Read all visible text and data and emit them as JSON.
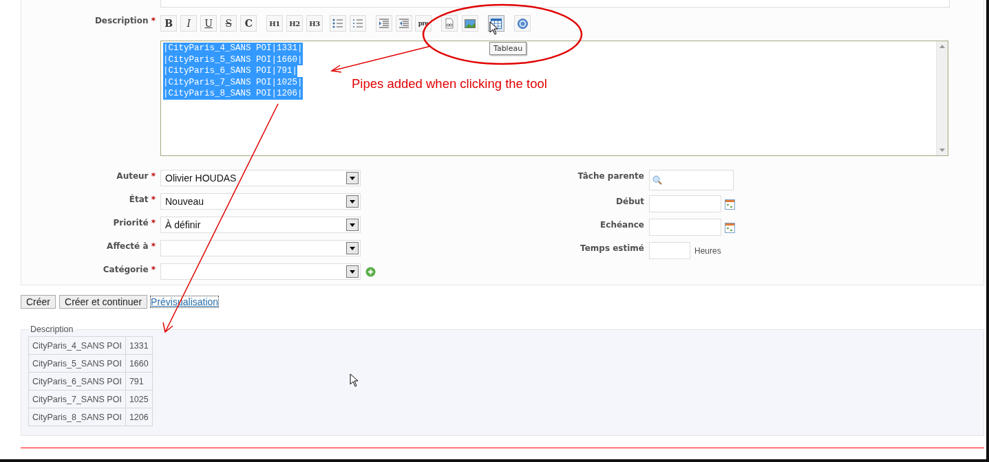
{
  "toolbar": [
    {
      "kind": "bold",
      "label": "B",
      "highlighted": false
    },
    {
      "kind": "italic",
      "label": "I",
      "highlighted": false
    },
    {
      "kind": "underline",
      "label": "U",
      "highlighted": false
    },
    {
      "kind": "strike",
      "label": "S",
      "highlighted": false
    },
    {
      "kind": "code",
      "label": "C",
      "highlighted": false
    },
    {
      "kind": "heading",
      "label": "H1",
      "highlighted": false
    },
    {
      "kind": "heading",
      "label": "H2",
      "highlighted": false
    },
    {
      "kind": "heading",
      "label": "H3",
      "highlighted": false
    },
    {
      "kind": "bullet-list",
      "highlighted": false
    },
    {
      "kind": "numbered-list",
      "highlighted": false
    },
    {
      "kind": "indent",
      "highlighted": false
    },
    {
      "kind": "outdent",
      "highlighted": false
    },
    {
      "kind": "pre",
      "label": "pre",
      "highlighted": false
    },
    {
      "kind": "link",
      "highlighted": false
    },
    {
      "kind": "image",
      "highlighted": false
    },
    {
      "kind": "table",
      "highlighted": true
    },
    {
      "kind": "help",
      "highlighted": false
    }
  ],
  "tooltip": {
    "text": "Tableau"
  },
  "description": {
    "label": "Description",
    "required_mark": "*",
    "selected": true,
    "lines": [
      "|CityParis_4_SANS POI|1331|",
      "|CityParis_5_SANS POI|1660|",
      "|CityParis_6_SANS POI|791|",
      "|CityParis_7_SANS POI|1025|",
      "|CityParis_8_SANS POI|1206|"
    ]
  },
  "left_fields": [
    {
      "label": "Auteur",
      "required_mark": "*",
      "value": "Olivier HOUDAS",
      "add_button": false
    },
    {
      "label": "État",
      "required_mark": "*",
      "value": "Nouveau",
      "add_button": false
    },
    {
      "label": "Priorité",
      "required_mark": "*",
      "value": "À définir",
      "add_button": false
    },
    {
      "label": "Affecté à",
      "required_mark": "*",
      "add_button": false
    },
    {
      "label": "Catégorie",
      "required_mark": "*",
      "add_button": true
    }
  ],
  "right_fields": [
    {
      "kind": "search",
      "label": "Tâche parente"
    },
    {
      "kind": "date",
      "label": "Début"
    },
    {
      "kind": "date",
      "label": "Echéance"
    },
    {
      "kind": "number",
      "label": "Temps estimé",
      "unit": "Heures"
    }
  ],
  "buttons": [
    "Créer",
    "Créer et continuer"
  ],
  "preview_link": {
    "text": "Prévisualisation",
    "focused": true
  },
  "preview": {
    "legend": "Description",
    "rows": [
      [
        "CityParis_4_SANS POI",
        "1331"
      ],
      [
        "CityParis_5_SANS POI",
        "1660"
      ],
      [
        "CityParis_6_SANS POI",
        "791"
      ],
      [
        "CityParis_7_SANS POI",
        "1025"
      ],
      [
        "CityParis_8_SANS POI",
        "1206"
      ]
    ]
  },
  "annotation": {
    "text": "Pipes added when clicking the tool"
  }
}
